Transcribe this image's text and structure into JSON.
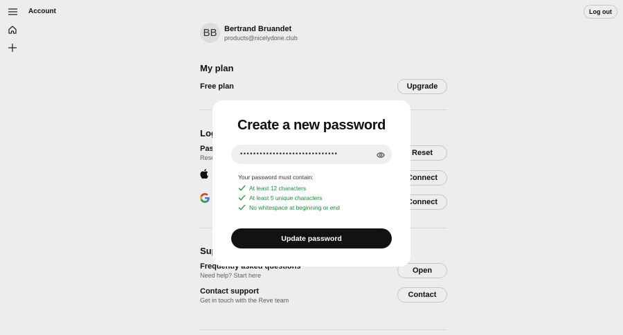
{
  "header": {
    "title": "Account",
    "logout_label": "Log out"
  },
  "rail": {
    "icons": [
      "menu-icon",
      "home-icon",
      "plus-icon"
    ]
  },
  "profile": {
    "initials": "BB",
    "name": "Bertrand Bruandet",
    "email": "products@nicelydone.club"
  },
  "plan": {
    "section_title": "My plan",
    "plan_name": "Free plan",
    "upgrade_label": "Upgrade"
  },
  "login": {
    "section_title": "Log",
    "password_title": "Pass",
    "password_sub": "Rese",
    "reset_label": "Reset",
    "apple_connect_label": "Connect",
    "google_connect_label": "Connect"
  },
  "support": {
    "section_title": "Sup",
    "faq_title": "Frequently asked questions",
    "faq_sub": "Need help? Start here",
    "faq_button": "Open",
    "contact_title": "Contact support",
    "contact_sub": "Get in touch with the Reve team",
    "contact_button": "Contact"
  },
  "modal": {
    "title": "Create a new password",
    "password_value": "••••••••••••••••••••••••••••••",
    "requirements_title": "Your password must contain:",
    "requirements": [
      "At least 12 characters",
      "At least 5 unique characters",
      "No whitespace at beginning or end"
    ],
    "submit_label": "Update password"
  },
  "colors": {
    "check": "#1e8a3c",
    "primary_button": "#121212"
  }
}
